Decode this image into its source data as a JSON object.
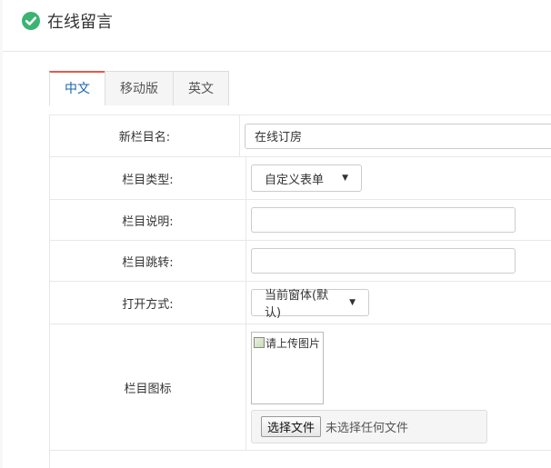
{
  "header": {
    "title": "在线留言",
    "icon": "check-circle-icon",
    "accent": "#3cb371"
  },
  "tabs": [
    {
      "label": "中文",
      "active": true
    },
    {
      "label": "移动版",
      "active": false
    },
    {
      "label": "英文",
      "active": false
    }
  ],
  "form": {
    "name": {
      "label": "新栏目名:",
      "value": "在线订房"
    },
    "type": {
      "label": "栏目类型:",
      "selected": "自定义表单"
    },
    "desc": {
      "label": "栏目说明:",
      "value": ""
    },
    "jump": {
      "label": "栏目跳转:",
      "value": ""
    },
    "open": {
      "label": "打开方式:",
      "selected": "当前窗体(默认)"
    },
    "icon": {
      "label": "栏目图标",
      "image_alt": "请上传图片",
      "file_button": "选择文件",
      "file_status": "未选择任何文件"
    }
  },
  "colors": {
    "tab_active_text": "#1a64a8",
    "tab_active_border": "#e55a4a"
  }
}
